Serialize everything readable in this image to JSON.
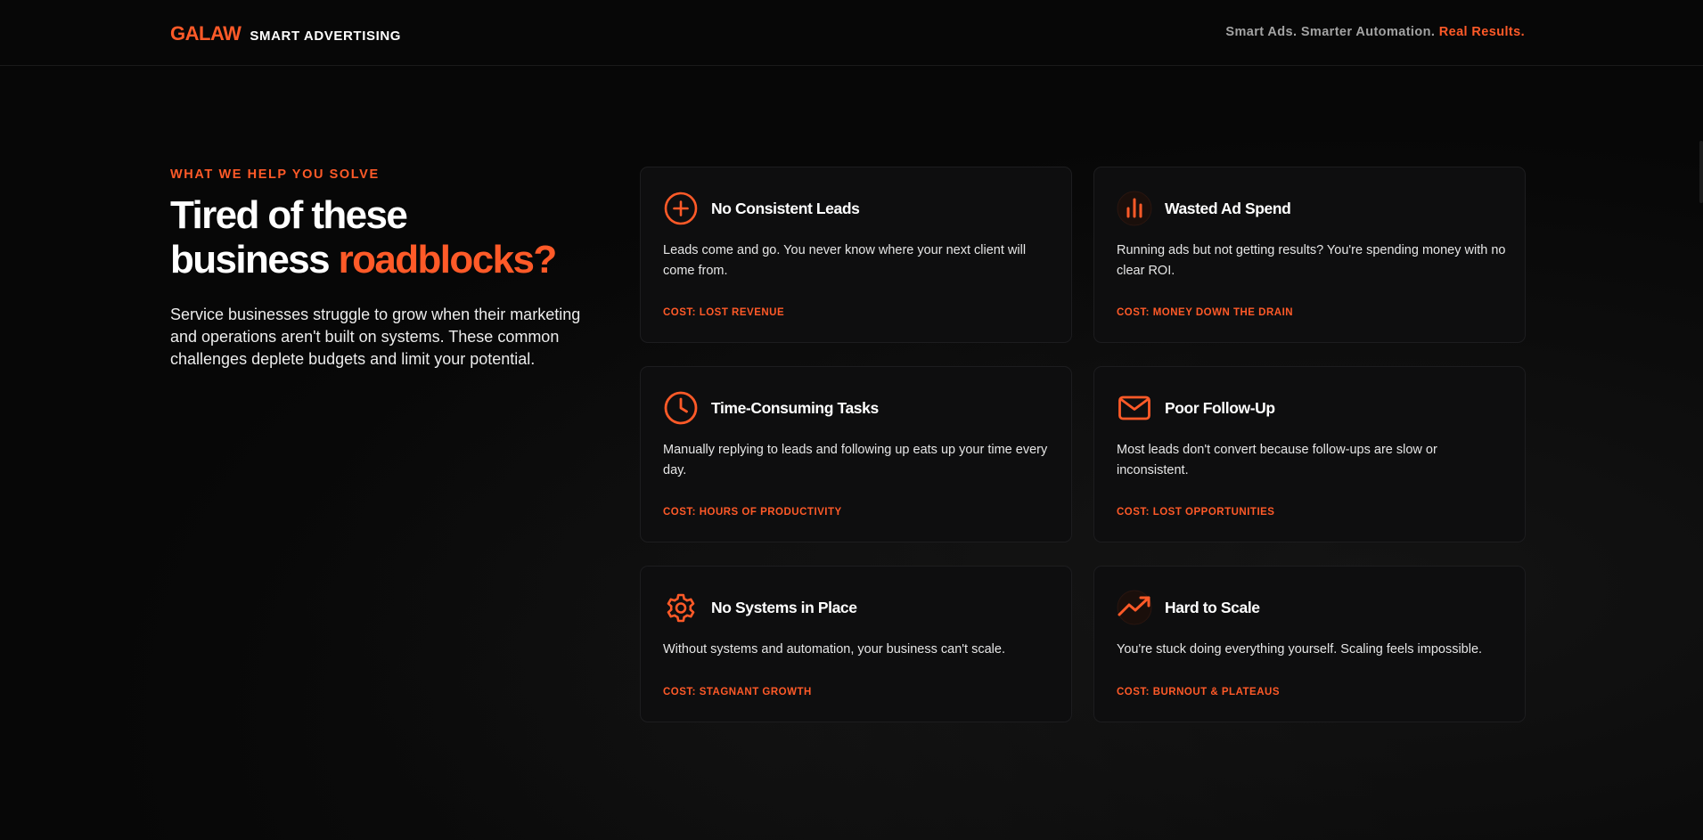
{
  "header": {
    "logo_mark": "GALAW",
    "logo_sub": "SMART ADVERTISING",
    "tagline_plain": "Smart Ads. Smarter Automation. ",
    "tagline_accent": "Real Results."
  },
  "intro": {
    "eyebrow": "WHAT WE HELP YOU SOLVE",
    "headline_line1": "Tired of these",
    "headline_line2_plain": "business ",
    "headline_line2_accent": "roadblocks?",
    "lede": "Service businesses struggle to grow when their marketing and operations aren't built on systems. These common challenges deplete budgets and limit your potential."
  },
  "cards": [
    {
      "icon": "plus-circle-icon",
      "title": "No Consistent Leads",
      "description": "Leads come and go. You never know where your next client will come from.",
      "cost": "COST: LOST REVENUE"
    },
    {
      "icon": "bar-chart-icon",
      "title": "Wasted Ad Spend",
      "description": "Running ads but not getting results? You're spending money with no clear ROI.",
      "cost": "COST: MONEY DOWN THE DRAIN"
    },
    {
      "icon": "clock-icon",
      "title": "Time-Consuming Tasks",
      "description": "Manually replying to leads and following up eats up your time every day.",
      "cost": "COST: HOURS OF PRODUCTIVITY"
    },
    {
      "icon": "mail-icon",
      "title": "Poor Follow-Up",
      "description": "Most leads don't convert because follow-ups are slow or inconsistent.",
      "cost": "COST: LOST OPPORTUNITIES"
    },
    {
      "icon": "gear-icon",
      "title": "No Systems in Place",
      "description": "Without systems and automation, your business can't scale.",
      "cost": "COST: STAGNANT GROWTH"
    },
    {
      "icon": "trending-up-icon",
      "title": "Hard to Scale",
      "description": "You're stuck doing everything yourself. Scaling feels impossible.",
      "cost": "COST: BURNOUT & PLATEAUS"
    }
  ],
  "colors": {
    "accent": "#ff5a28",
    "background": "#070707",
    "card_background": "#0e0e0f",
    "card_border": "#1d1d1f"
  }
}
